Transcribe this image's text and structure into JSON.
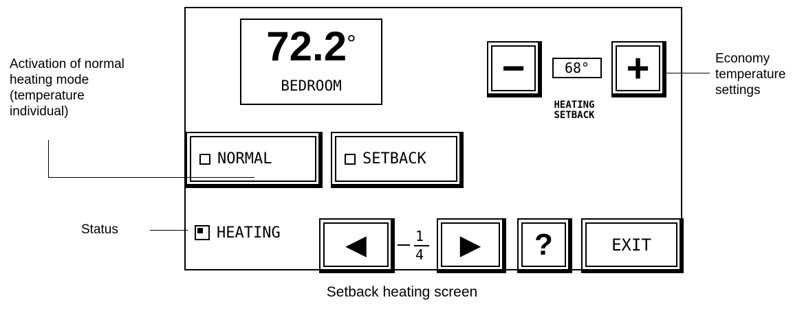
{
  "display": {
    "temperature": "72.2",
    "degree": "°",
    "room": "BEDROOM"
  },
  "economy": {
    "minus_symbol": "−",
    "plus_symbol": "+",
    "setpoint": "68°",
    "caption_line1": "HEATING",
    "caption_line2": "SETBACK"
  },
  "modes": {
    "normal_label": "NORMAL",
    "setback_label": "SETBACK"
  },
  "status": {
    "heating_label": "HEATING",
    "heating_active": true
  },
  "nav": {
    "prev_symbol": "◀",
    "next_symbol": "▶",
    "page_current": "1",
    "page_total": "4",
    "help_symbol": "?",
    "exit_label": "EXIT"
  },
  "annotations": {
    "activation": [
      "Activation of normal",
      "heating mode",
      "(temperature",
      "individual)"
    ],
    "economy": [
      "Economy",
      "temperature",
      "settings"
    ],
    "status": "Status"
  },
  "caption": "Setback heating screen"
}
